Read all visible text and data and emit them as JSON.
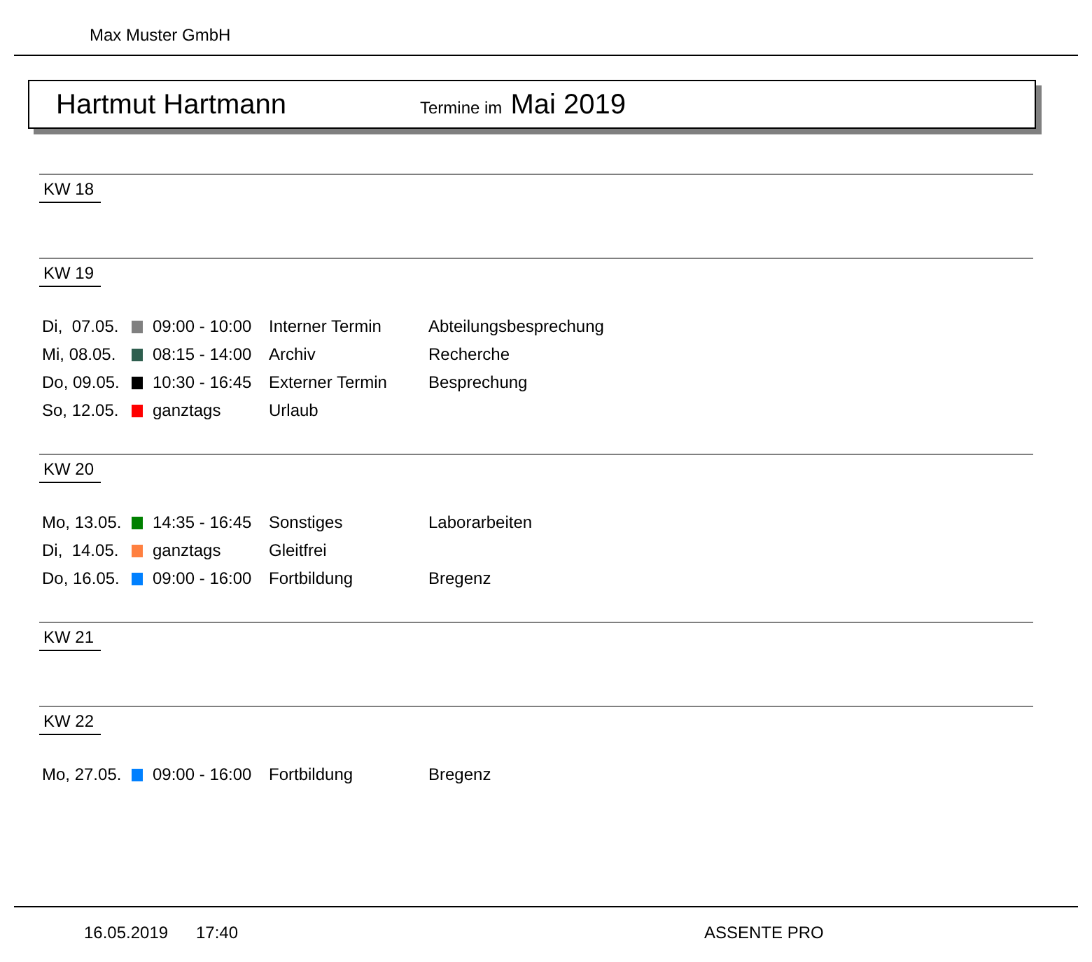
{
  "company": "Max Muster GmbH",
  "title": {
    "name": "Hartmut Hartmann",
    "prefix": "Termine im",
    "period": "Mai 2019"
  },
  "weeks": [
    {
      "label": "KW 18"
    },
    {
      "label": "KW 19",
      "entries": [
        {
          "day": "Di,  07.05.",
          "color": "#808080",
          "time": "09:00 - 10:00",
          "type": "Interner Termin",
          "description": "Abteilungsbesprechung"
        },
        {
          "day": "Mi, 08.05.",
          "color": "#2e5e4e",
          "time": "08:15 - 14:00",
          "type": "Archiv",
          "description": "Recherche"
        },
        {
          "day": "Do, 09.05.",
          "color": "#000000",
          "time": "10:30 - 16:45",
          "type": "Externer Termin",
          "description": "Besprechung"
        },
        {
          "day": "So, 12.05.",
          "color": "#ff0000",
          "time": "ganztags",
          "type": "Urlaub"
        }
      ]
    },
    {
      "label": "KW 20",
      "entries": [
        {
          "day": "Mo, 13.05.",
          "color": "#008000",
          "time": "14:35 - 16:45",
          "type": "Sonstiges",
          "description": "Laborarbeiten"
        },
        {
          "day": "Di,  14.05.",
          "color": "#ff8040",
          "time": "ganztags",
          "type": "Gleitfrei"
        },
        {
          "day": "Do, 16.05.",
          "color": "#0080ff",
          "time": "09:00 - 16:00",
          "type": "Fortbildung",
          "description": "Bregenz"
        }
      ]
    },
    {
      "label": "KW 21"
    },
    {
      "label": "KW 22",
      "entries": [
        {
          "day": "Mo, 27.05.",
          "color": "#0080ff",
          "time": "09:00 - 16:00",
          "type": "Fortbildung",
          "description": "Bregenz"
        }
      ]
    }
  ],
  "footer": {
    "date": "16.05.2019",
    "time": "17:40",
    "product": "ASSENTE PRO"
  }
}
